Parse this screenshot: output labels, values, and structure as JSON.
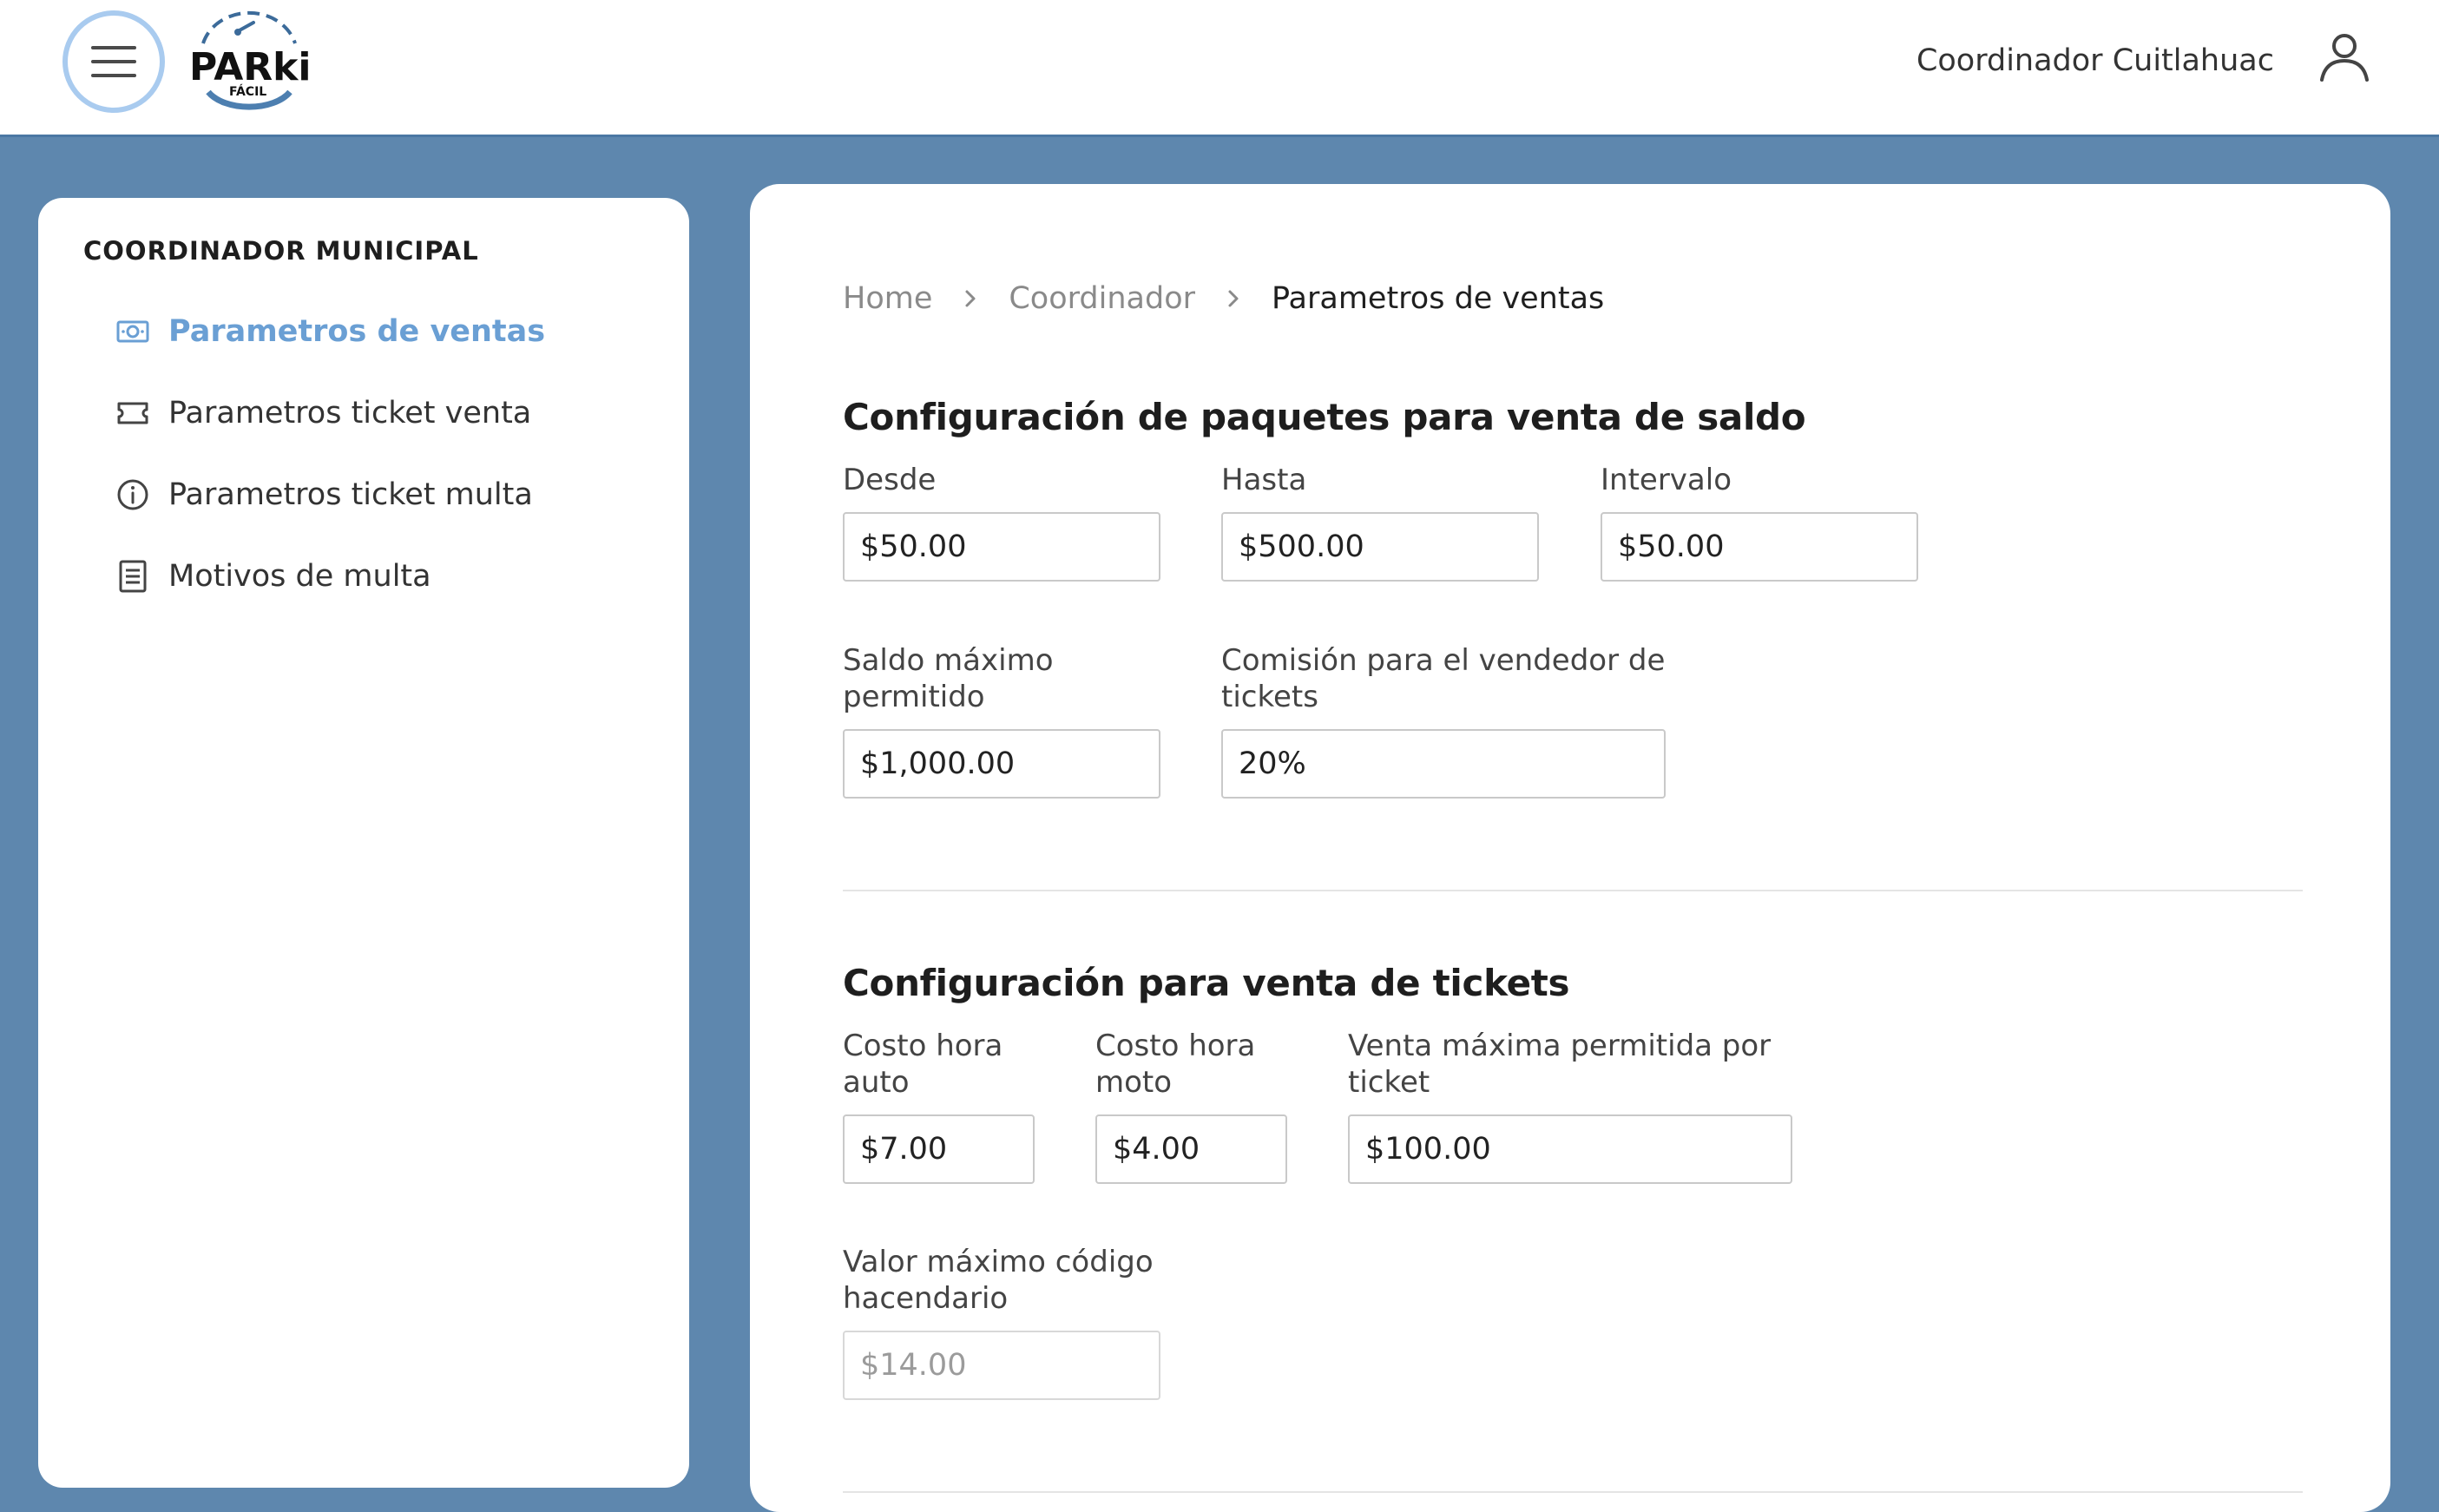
{
  "header": {
    "logo_text": "PARki",
    "logo_subtext": "FÁCIL",
    "user_name": "Coordinador Cuitlahuac",
    "icons": {
      "menu": "hamburger-menu-icon",
      "user": "user-icon"
    }
  },
  "sidebar": {
    "title": "COORDINADOR MUNICIPAL",
    "items": [
      {
        "label": "Parametros de ventas",
        "icon": "banknote-icon",
        "active": true
      },
      {
        "label": "Parametros ticket venta",
        "icon": "ticket-icon",
        "active": false
      },
      {
        "label": "Parametros ticket multa",
        "icon": "info-circle-icon",
        "active": false
      },
      {
        "label": "Motivos de multa",
        "icon": "document-list-icon",
        "active": false
      }
    ]
  },
  "breadcrumb": [
    "Home",
    "Coordinador",
    "Parametros de ventas"
  ],
  "sections": {
    "paquetes": {
      "title": "Configuración de paquetes para venta de saldo",
      "fields": {
        "desde": {
          "label": "Desde",
          "value": "$50.00"
        },
        "hasta": {
          "label": "Hasta",
          "value": "$500.00"
        },
        "intervalo": {
          "label": "Intervalo",
          "value": "$50.00"
        },
        "saldo_maximo": {
          "label": "Saldo máximo permitido",
          "value": "$1,000.00"
        },
        "comision": {
          "label": "Comisión para el vendedor de tickets",
          "value": "20%"
        }
      }
    },
    "tickets": {
      "title": "Configuración para venta de tickets",
      "fields": {
        "costo_auto": {
          "label": "Costo hora auto",
          "value": "$7.00"
        },
        "costo_moto": {
          "label": "Costo hora moto",
          "value": "$4.00"
        },
        "venta_maxima": {
          "label": "Venta máxima permitida por ticket",
          "value": "$100.00"
        },
        "valor_maximo_codigo": {
          "label": "Valor máximo código hacendario",
          "value": "$14.00",
          "disabled": true
        }
      }
    }
  },
  "colors": {
    "background": "#5e87ae",
    "accent": "#6a9fd4",
    "menu_ring": "#a9cbef"
  }
}
